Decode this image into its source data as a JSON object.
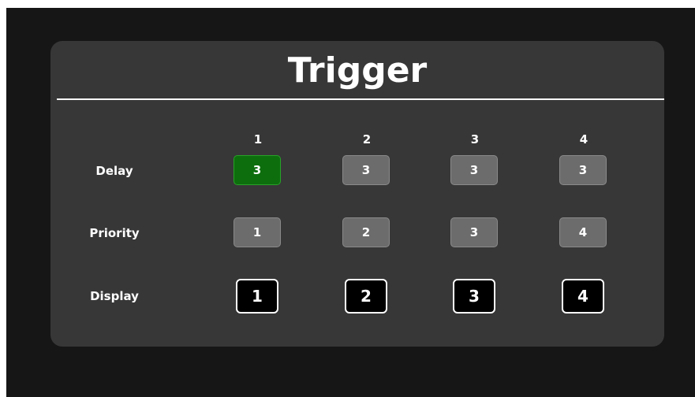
{
  "title": "Trigger",
  "columns": [
    "1",
    "2",
    "3",
    "4"
  ],
  "rows": {
    "delay": {
      "label": "Delay",
      "values": [
        "3",
        "3",
        "3",
        "3"
      ],
      "selected_index": 0
    },
    "priority": {
      "label": "Priority",
      "values": [
        "1",
        "2",
        "3",
        "4"
      ]
    },
    "display": {
      "label": "Display",
      "values": [
        "1",
        "2",
        "3",
        "4"
      ]
    }
  },
  "colors": {
    "background": "#161616",
    "panel": "#373737",
    "button": "#6c6c6c",
    "selected_button": "#0d6e0d",
    "display_button": "#000000",
    "text": "#ffffff"
  }
}
